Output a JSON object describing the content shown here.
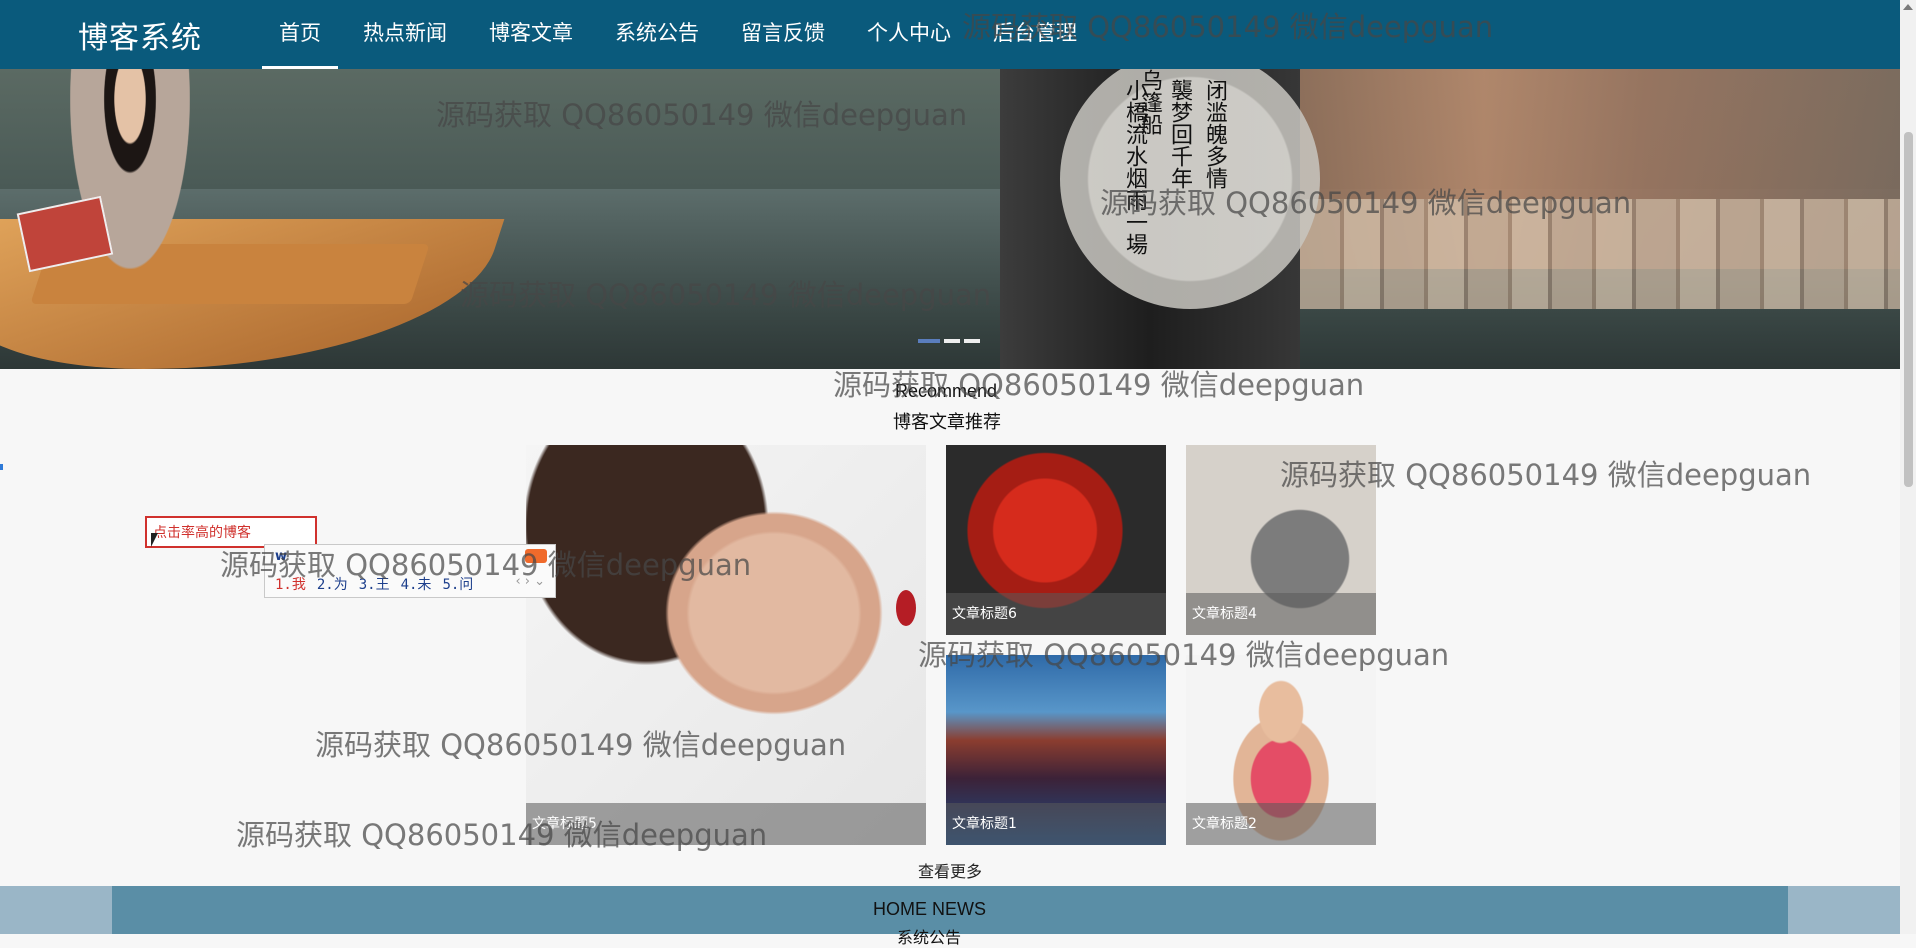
{
  "header": {
    "brand": "博客系统",
    "nav": [
      "首页",
      "热点新闻",
      "博客文章",
      "系统公告",
      "留言反馈",
      "个人中心",
      "后台管理"
    ],
    "active_index": 0
  },
  "banner": {
    "slide_count": 3,
    "active_slide": 0,
    "poster_text": [
      "小橋流水烟雨一場",
      "闭滥魄多情",
      "襲梦回千年",
      "乌篷船"
    ]
  },
  "recommend": {
    "title_en": "Recommend",
    "title_cn": "博客文章推荐",
    "cards": [
      {
        "caption": "文章标题5"
      },
      {
        "caption": "文章标题6"
      },
      {
        "caption": "文章标题4"
      },
      {
        "caption": "文章标题1"
      },
      {
        "caption": "文章标题2"
      }
    ],
    "more_label": "查看更多"
  },
  "search": {
    "value": "点击率高的博客"
  },
  "ime": {
    "input": "w",
    "candidates": [
      "1.我",
      "2.为",
      "3.王",
      "4.未",
      "5.问"
    ],
    "arrows": "‹ › ⌄"
  },
  "news": {
    "title_en": "HOME NEWS",
    "title_cn": "系统公告"
  },
  "watermark": "源码获取 QQ86050149 微信deepguan",
  "colors": {
    "nav_bg": "#0a5a7c",
    "search_border": "#d0312d",
    "news_bg": "#5a8ea6"
  }
}
